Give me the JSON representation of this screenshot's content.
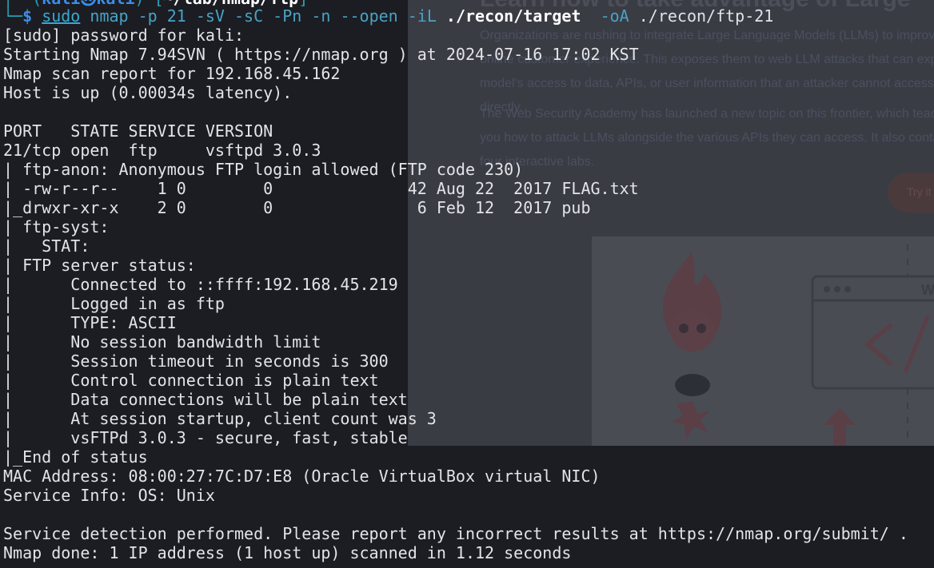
{
  "webpage": {
    "heading": "Learn how to take advantage of Large",
    "paragraph1": "Organizations are rushing to integrate Large Language Models (LLMs) to improve their online customer experience. This exposes them to web LLM attacks that can exploit the model's access to data, APIs, or user information that an attacker cannot access directly.",
    "paragraph2": "The Web Security Academy has launched a new topic on this frontier, which teaches you how to attack LLMs alongside the various APIs they can access. It also contains four interactive labs.",
    "button_label": "Try it",
    "window_label": "We"
  },
  "terminal": {
    "clipped_header": {
      "left": "┌──(",
      "host": "kali㉿kali",
      "mid": ")-[",
      "dir": "~/lab/nmap/ftp",
      "right": "]"
    },
    "prompt": {
      "corner": "└─",
      "dollar": "$",
      "sudo": "sudo",
      "cmd_args": " nmap -p 21 -sV -sC -Pn -n --open -iL ",
      "target_file": "./recon/target",
      "out_flag": "  -oA",
      "out_path": " ./recon/ftp-21"
    },
    "output": [
      "[sudo] password for kali:",
      "Starting Nmap 7.94SVN ( https://nmap.org ) at 2024-07-16 17:02 KST",
      "Nmap scan report for 192.168.45.162",
      "Host is up (0.00034s latency).",
      "",
      "PORT   STATE SERVICE VERSION",
      "21/tcp open  ftp     vsftpd 3.0.3",
      "| ftp-anon: Anonymous FTP login allowed (FTP code 230)",
      "| -rw-r--r--    1 0        0              42 Aug 22  2017 FLAG.txt",
      "|_drwxr-xr-x    2 0        0               6 Feb 12  2017 pub",
      "| ftp-syst:",
      "|   STAT:",
      "| FTP server status:",
      "|      Connected to ::ffff:192.168.45.219",
      "|      Logged in as ftp",
      "|      TYPE: ASCII",
      "|      No session bandwidth limit",
      "|      Session timeout in seconds is 300",
      "|      Control connection is plain text",
      "|      Data connections will be plain text",
      "|      At session startup, client count was 3",
      "|      vsFTPd 3.0.3 - secure, fast, stable",
      "|_End of status",
      "MAC Address: 08:00:27:7C:D7:E8 (Oracle VirtualBox virtual NIC)",
      "Service Info: OS: Unix",
      "",
      "Service detection performed. Please report any incorrect results at https://nmap.org/submit/ .",
      "Nmap done: 1 IP address (1 host up) scanned in 1.12 seconds"
    ]
  },
  "colors": {
    "terminal_bg": "#1b1d23",
    "text": "#e2e4e8",
    "prompt_accent": "#2aa1b3",
    "command": "#4aa2c4"
  }
}
